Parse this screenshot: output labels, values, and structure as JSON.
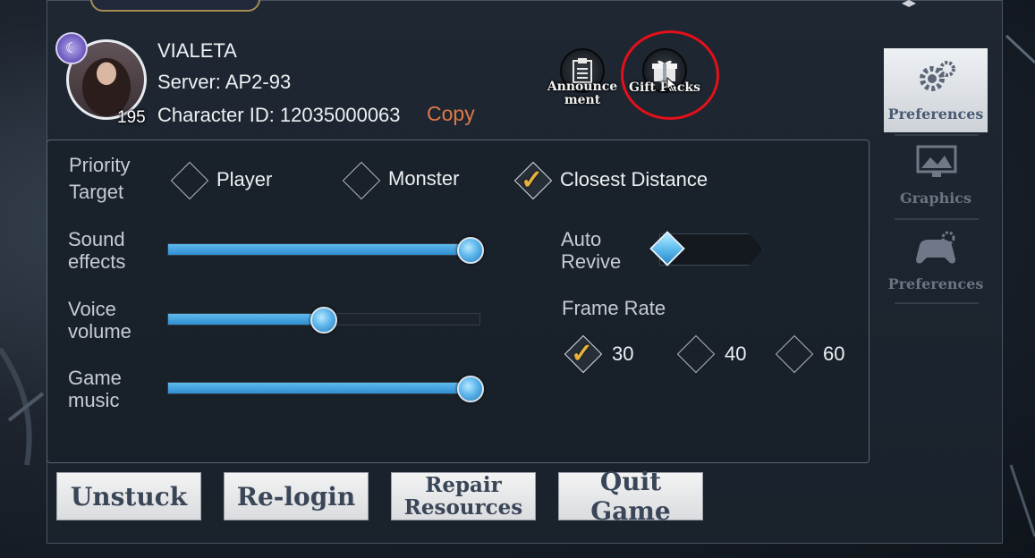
{
  "profile": {
    "name": "VIALETA",
    "server": "Server: AP2-93",
    "character_id": "Character ID: 12035000063",
    "copy_label": "Copy",
    "level": "195"
  },
  "top_icons": {
    "announcement_line1": "Announce",
    "announcement_line2": "ment",
    "gift_packs": "Gift Packs"
  },
  "settings": {
    "priority_target": {
      "label_line1": "Priority",
      "label_line2": "Target",
      "options": [
        "Player",
        "Monster",
        "Closest Distance"
      ],
      "selected": "Closest Distance"
    },
    "sound_effects": {
      "label_line1": "Sound",
      "label_line2": "effects",
      "level": 1.0
    },
    "voice_volume": {
      "label_line1": "Voice",
      "label_line2": "volume",
      "level": 0.5
    },
    "game_music": {
      "label_line1": "Game",
      "label_line2": "music",
      "level": 1.0
    },
    "auto_revive": {
      "label_line1": "Auto",
      "label_line2": "Revive",
      "enabled": false
    },
    "frame_rate": {
      "label": "Frame Rate",
      "options": [
        "30",
        "40",
        "60"
      ],
      "selected": "30"
    }
  },
  "side_tabs": [
    {
      "label": "Preferences",
      "icon": "gears-icon",
      "active": true
    },
    {
      "label": "Graphics",
      "icon": "monitor-icon",
      "active": false
    },
    {
      "label": "Preferences",
      "icon": "gamepad-icon",
      "active": false
    }
  ],
  "bottom_buttons": {
    "unstuck": "Unstuck",
    "relogin": "Re-login",
    "repair_line1": "Repair",
    "repair_line2": "Resources",
    "quit": "Quit Game"
  },
  "colors": {
    "accent_blue": "#4aa8e2",
    "check_gold": "#e7b23c",
    "copy_orange": "#e07848",
    "highlight_red": "#e4101a"
  }
}
